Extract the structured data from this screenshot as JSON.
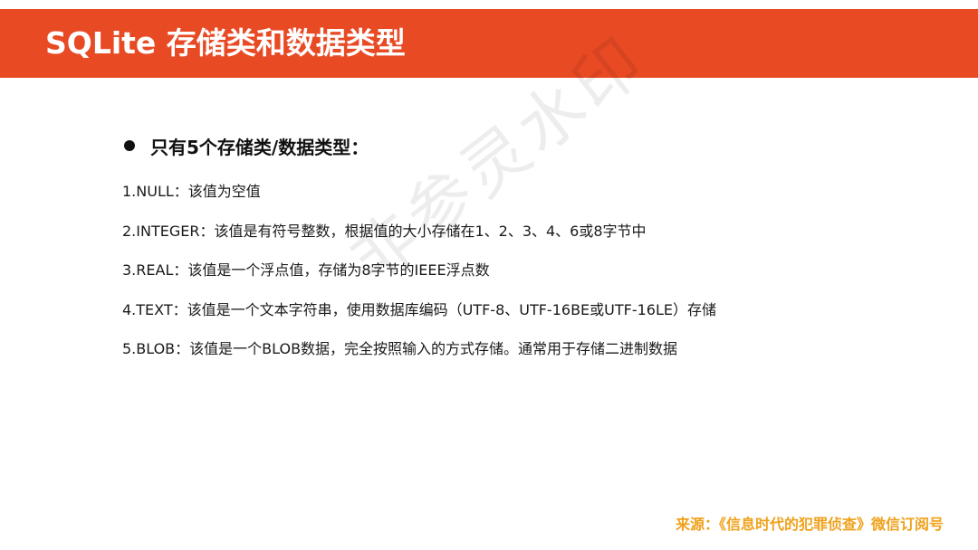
{
  "header": {
    "title": "SQLite 存储类和数据类型"
  },
  "main": {
    "subheading": "只有5个存储类/数据类型：",
    "items": [
      "1.NULL：该值为空值",
      "2.INTEGER：该值是有符号整数，根据值的大小存储在1、2、3、4、6或8字节中",
      "3.REAL：该值是一个浮点值，存储为8字节的IEEE浮点数",
      "4.TEXT：该值是一个文本字符串，使用数据库编码（UTF-8、UTF-16BE或UTF-16LE）存储",
      "5.BLOB：该值是一个BLOB数据，完全按照输入的方式存储。通常用于存储二进制数据"
    ]
  },
  "watermark": {
    "text": "非参灵水印"
  },
  "footer": {
    "source": "来源：《信息时代的犯罪侦查》微信订阅号"
  }
}
